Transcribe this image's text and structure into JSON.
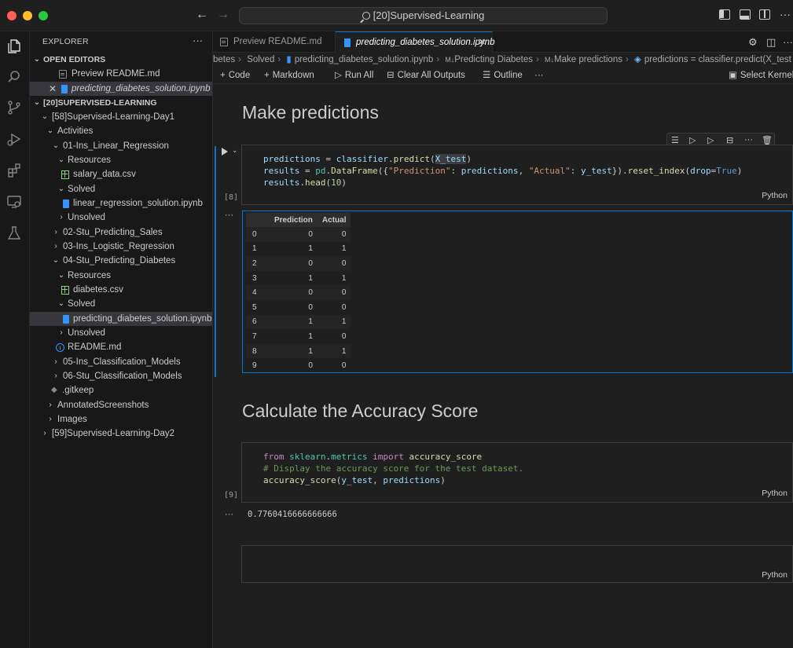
{
  "window": {
    "title": "[20]Supervised-Learning"
  },
  "sidebar": {
    "title": "EXPLORER",
    "open_editors_header": "OPEN EDITORS",
    "open_editors": [
      {
        "label": "Preview README.md"
      },
      {
        "label": "predicting_diabetes_solution.ipynb"
      }
    ],
    "workspace_header": "[20]SUPERVISED-LEARNING",
    "tree": [
      {
        "label": "[58]Supervised-Learning-Day1"
      },
      {
        "label": "Activities"
      },
      {
        "label": "01-Ins_Linear_Regression"
      },
      {
        "label": "Resources"
      },
      {
        "label": "salary_data.csv"
      },
      {
        "label": "Solved"
      },
      {
        "label": "linear_regression_solution.ipynb"
      },
      {
        "label": "Unsolved"
      },
      {
        "label": "02-Stu_Predicting_Sales"
      },
      {
        "label": "03-Ins_Logistic_Regression"
      },
      {
        "label": "04-Stu_Predicting_Diabetes"
      },
      {
        "label": "Resources"
      },
      {
        "label": "diabetes.csv"
      },
      {
        "label": "Solved"
      },
      {
        "label": "predicting_diabetes_solution.ipynb"
      },
      {
        "label": "Unsolved"
      },
      {
        "label": "README.md"
      },
      {
        "label": "05-Ins_Classification_Models"
      },
      {
        "label": "06-Stu_Classification_Models"
      },
      {
        "label": ".gitkeep"
      },
      {
        "label": "AnnotatedScreenshots"
      },
      {
        "label": "Images"
      },
      {
        "label": "[59]Supervised-Learning-Day2"
      }
    ]
  },
  "tabs": [
    {
      "label": "Preview README.md"
    },
    {
      "label": "predicting_diabetes_solution.ipynb"
    }
  ],
  "breadcrumb": [
    "betes",
    "Solved",
    "predicting_diabetes_solution.ipynb",
    "Predicting Diabetes",
    "Make predictions",
    "predictions = classifier.predict(X_test"
  ],
  "breadcrumb_md_prefix": "M↓",
  "toolbar": {
    "code": "Code",
    "markdown": "Markdown",
    "run_all": "Run All",
    "clear_outputs": "Clear All Outputs",
    "outline": "Outline",
    "select_kernel": "Select Kernel"
  },
  "notebook": {
    "heading1": "Make predictions",
    "cell1": {
      "exec": "[8]",
      "lang": "Python"
    },
    "df": {
      "columns": [
        "",
        "Prediction",
        "Actual"
      ],
      "rows": [
        [
          "0",
          "0",
          "0"
        ],
        [
          "1",
          "1",
          "1"
        ],
        [
          "2",
          "0",
          "0"
        ],
        [
          "3",
          "1",
          "1"
        ],
        [
          "4",
          "0",
          "0"
        ],
        [
          "5",
          "0",
          "0"
        ],
        [
          "6",
          "1",
          "1"
        ],
        [
          "7",
          "1",
          "0"
        ],
        [
          "8",
          "1",
          "1"
        ],
        [
          "9",
          "0",
          "0"
        ]
      ]
    },
    "heading2": "Calculate the Accuracy Score",
    "cell2": {
      "exec": "[9]",
      "lang": "Python",
      "output": "0.7760416666666666"
    },
    "cell3": {
      "lang": "Python"
    }
  },
  "colors": {
    "accent": "#0078d4",
    "background": "#1f1f1f",
    "sidebar": "#181818"
  }
}
